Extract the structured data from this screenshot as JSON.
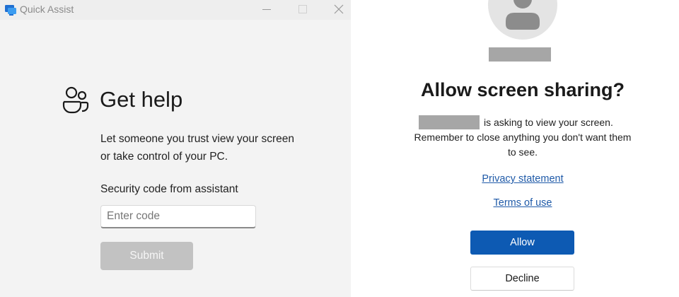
{
  "left_window": {
    "app_title": "Quick Assist",
    "heading": "Get help",
    "description_lines": [
      "Let someone you trust view your screen",
      "or take control of your PC."
    ],
    "code_label": "Security code from assistant",
    "code_input": {
      "placeholder": "Enter code",
      "value": ""
    },
    "submit_label": "Submit",
    "icons": {
      "app": "quick-assist-icon",
      "minimize": "minimize-icon",
      "maximize": "maximize-icon",
      "close": "close-icon",
      "people": "people-icon"
    }
  },
  "right_panel": {
    "heading": "Allow screen sharing?",
    "request_text": "is asking to view your screen.",
    "reminder_line1": "Remember to close anything you don't want them",
    "reminder_line2": "to see.",
    "privacy_link": "Privacy statement",
    "terms_link": "Terms of use",
    "allow_label": "Allow",
    "decline_label": "Decline",
    "icons": {
      "avatar": "person-avatar-icon"
    }
  },
  "colors": {
    "accent": "#0d5ab3",
    "link": "#1f5aa8",
    "disabled_button": "#c2c2c2",
    "redaction": "#a6a6a6"
  }
}
